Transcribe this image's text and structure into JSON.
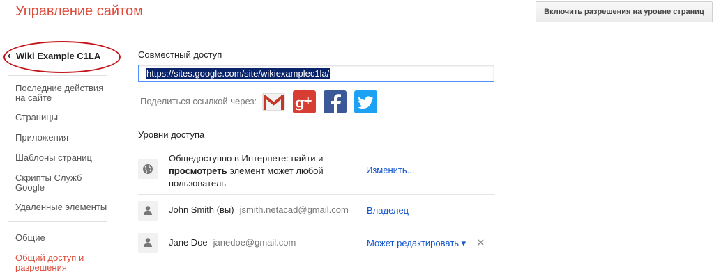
{
  "header": {
    "title": "Управление сайтом",
    "enable_button": "Включить разрешения на уровне страниц"
  },
  "sidebar": {
    "site_name": "Wiki Example C1LA",
    "items": [
      {
        "label": "Последние действия на сайте"
      },
      {
        "label": "Страницы"
      },
      {
        "label": "Приложения"
      },
      {
        "label": "Шаблоны страниц"
      },
      {
        "label": "Скрипты Служб Google"
      },
      {
        "label": "Удаленные элементы"
      },
      {
        "label": "Общие"
      },
      {
        "label": "Общий доступ и разрешения",
        "active": true
      }
    ]
  },
  "sharing": {
    "label": "Совместный доступ",
    "link_value": "https://sites.google.com/site/wikiexamplec1la/",
    "share_via_label": "Поделиться ссылкой через:",
    "share_icons": [
      "gmail-icon",
      "google-plus-icon",
      "facebook-icon",
      "twitter-icon"
    ],
    "colors": {
      "gmail": "#c53727",
      "google_plus": "#d73d32",
      "facebook": "#3b5998",
      "twitter": "#1da1f2"
    }
  },
  "access": {
    "label": "Уровни доступа",
    "public": {
      "line1": "Общедоступно в Интернете: найти и",
      "bold": "просмотреть",
      "line2_rest": " элемент может любой",
      "line3": "пользователь",
      "action": "Изменить..."
    },
    "users": [
      {
        "name": "John Smith (вы)",
        "email": "jsmith.netacad@gmail.com",
        "role": "Владелец"
      },
      {
        "name": "Jane Doe",
        "email": "janedoe@gmail.com",
        "role": "Может редактировать ▾"
      }
    ],
    "remove_symbol": "✕"
  },
  "colors": {
    "title": "#dd4b39",
    "link": "#1155cc",
    "annotation_oval": "#c3161c"
  }
}
